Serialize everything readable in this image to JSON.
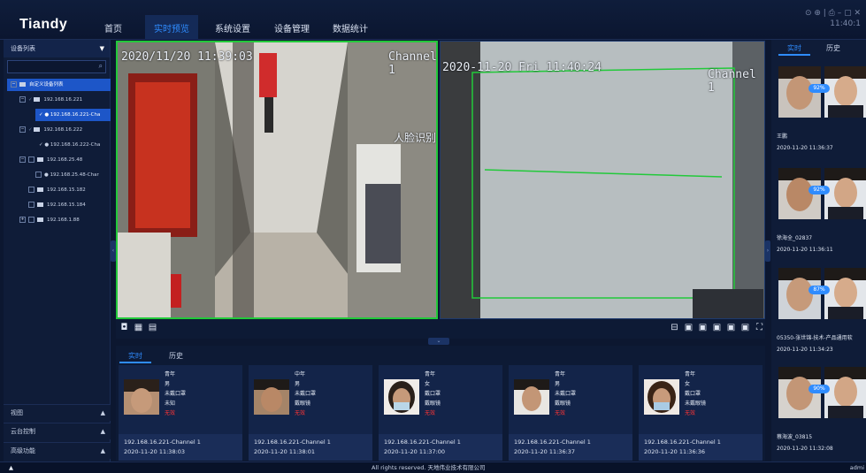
{
  "brand": {
    "logo": "Tiandy"
  },
  "nav": [
    "首页",
    "实时预览",
    "系统设置",
    "设备管理",
    "数据统计"
  ],
  "window": {
    "controls": "⊙ ⊕ | ⎙ – ▢ ✕",
    "clock": "11:40:1"
  },
  "sidebar": {
    "title": "设备列表",
    "search_placeholder": "",
    "tree": [
      {
        "label": "自定义设备列表",
        "selected": true
      },
      {
        "label": "192.168.16.221"
      },
      {
        "label": "192.168.16.221-Cha",
        "selected": true
      },
      {
        "label": "192.168.16.222"
      },
      {
        "label": "192.168.16.222-Cha"
      },
      {
        "label": "192.168.25.48"
      },
      {
        "label": "192.168.25.48-Char"
      },
      {
        "label": "192.168.15.182"
      },
      {
        "label": "192.168.15.184"
      },
      {
        "label": "192.168.1.88"
      }
    ],
    "accordion": [
      "视图",
      "云台控制",
      "高级功能"
    ]
  },
  "video": {
    "left": {
      "timestamp": "2020/11/20 11:39:03",
      "channel": "Channel 1",
      "overlay": "人脸识别"
    },
    "right": {
      "timestamp": "2020-11-20 Fri 11:40:24",
      "channel": "Channel 1"
    }
  },
  "bottom": {
    "tabs": [
      "实时",
      "历史"
    ],
    "cards": [
      {
        "attrs": [
          "青年",
          "男",
          "未戴口罩",
          "未知"
        ],
        "alert": "无效",
        "channel": "192.168.16.221-Channel 1",
        "time": "2020-11-20 11:38:03"
      },
      {
        "attrs": [
          "中年",
          "男",
          "未戴口罩",
          "戴眼镜"
        ],
        "alert": "无效",
        "channel": "192.168.16.221-Channel 1",
        "time": "2020-11-20 11:38:01"
      },
      {
        "attrs": [
          "青年",
          "女",
          "戴口罩",
          "戴眼镜"
        ],
        "alert": "无效",
        "channel": "192.168.16.221-Channel 1",
        "time": "2020-11-20 11:37:00"
      },
      {
        "attrs": [
          "青年",
          "男",
          "未戴口罩",
          "戴眼镜"
        ],
        "alert": "无效",
        "channel": "192.168.16.221-Channel 1",
        "time": "2020-11-20 11:36:37"
      },
      {
        "attrs": [
          "青年",
          "女",
          "戴口罩",
          "未戴眼镜"
        ],
        "alert": "无效",
        "channel": "192.168.16.221-Channel 1",
        "time": "2020-11-20 11:36:36"
      }
    ]
  },
  "right": {
    "tabs": [
      "实时",
      "历史"
    ],
    "items": [
      {
        "score": "92%",
        "name": "王鹏",
        "time": "2020-11-20 11:36:37"
      },
      {
        "score": "92%",
        "name": "徐海全_02837",
        "time": "2020-11-20 11:36:11"
      },
      {
        "score": "87%",
        "name": "05350-张世锦-技术-产品通用软",
        "time": "2020-11-20 11:34:23"
      },
      {
        "score": "90%",
        "name": "蔡海波_03815",
        "time": "2020-11-20 11:32:08"
      }
    ]
  },
  "footer": {
    "copyright": "All rights reserved. 天地伟业技术有限公司",
    "user": "admi"
  },
  "colors": {
    "accent": "#2f8cff",
    "alert": "#ff3535",
    "detect": "#22c93a"
  }
}
